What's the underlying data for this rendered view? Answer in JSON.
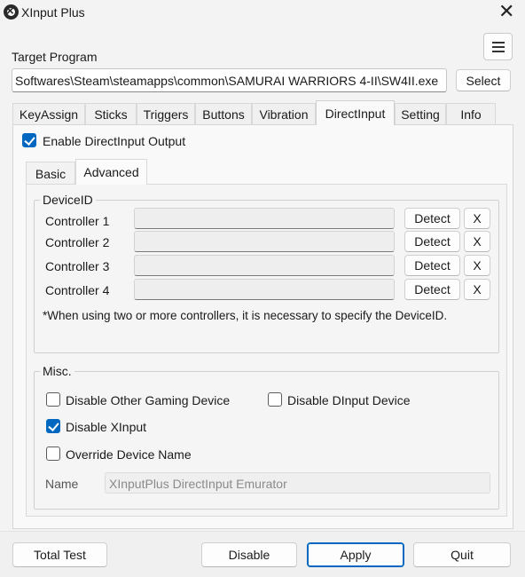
{
  "window": {
    "title": "XInput Plus",
    "close_glyph": "✕",
    "menu_icon": "hamburger-icon",
    "app_icon": "xinput-plus-icon"
  },
  "target": {
    "label": "Target Program",
    "path": "Softwares\\Steam\\steamapps\\common\\SAMURAI WARRIORS 4-II\\SW4II.exe",
    "select_label": "Select"
  },
  "tabs": [
    {
      "label": "KeyAssign",
      "active": false
    },
    {
      "label": "Sticks",
      "active": false
    },
    {
      "label": "Triggers",
      "active": false
    },
    {
      "label": "Buttons",
      "active": false
    },
    {
      "label": "Vibration",
      "active": false
    },
    {
      "label": "DirectInput",
      "active": true
    },
    {
      "label": "Setting",
      "active": false
    },
    {
      "label": "Info",
      "active": false
    }
  ],
  "directinput": {
    "enable_label": "Enable DirectInput Output",
    "enable_checked": true,
    "subtabs": [
      {
        "label": "Basic",
        "active": false
      },
      {
        "label": "Advanced",
        "active": true
      }
    ],
    "device_group": {
      "title": "DeviceID",
      "controllers": [
        {
          "label": "Controller 1",
          "value": "",
          "detect_label": "Detect",
          "clear_label": "X"
        },
        {
          "label": "Controller 2",
          "value": "",
          "detect_label": "Detect",
          "clear_label": "X"
        },
        {
          "label": "Controller 3",
          "value": "",
          "detect_label": "Detect",
          "clear_label": "X"
        },
        {
          "label": "Controller 4",
          "value": "",
          "detect_label": "Detect",
          "clear_label": "X"
        }
      ],
      "note": "*When using two or more controllers, it is necessary to specify the DeviceID."
    },
    "misc_group": {
      "title": "Misc.",
      "disable_other_gaming": {
        "label": "Disable Other Gaming Device",
        "checked": false
      },
      "disable_dinput": {
        "label": "Disable DInput Device",
        "checked": false
      },
      "disable_xinput": {
        "label": "Disable XInput",
        "checked": true
      },
      "override_name": {
        "label": "Override Device Name",
        "checked": false
      },
      "name_label": "Name",
      "name_value": "XInputPlus DirectInput Emurator"
    }
  },
  "footer": {
    "total_test": "Total Test",
    "disable": "Disable",
    "apply": "Apply",
    "quit": "Quit"
  },
  "colors": {
    "accent": "#0067c0",
    "background": "#f3f3f3"
  }
}
